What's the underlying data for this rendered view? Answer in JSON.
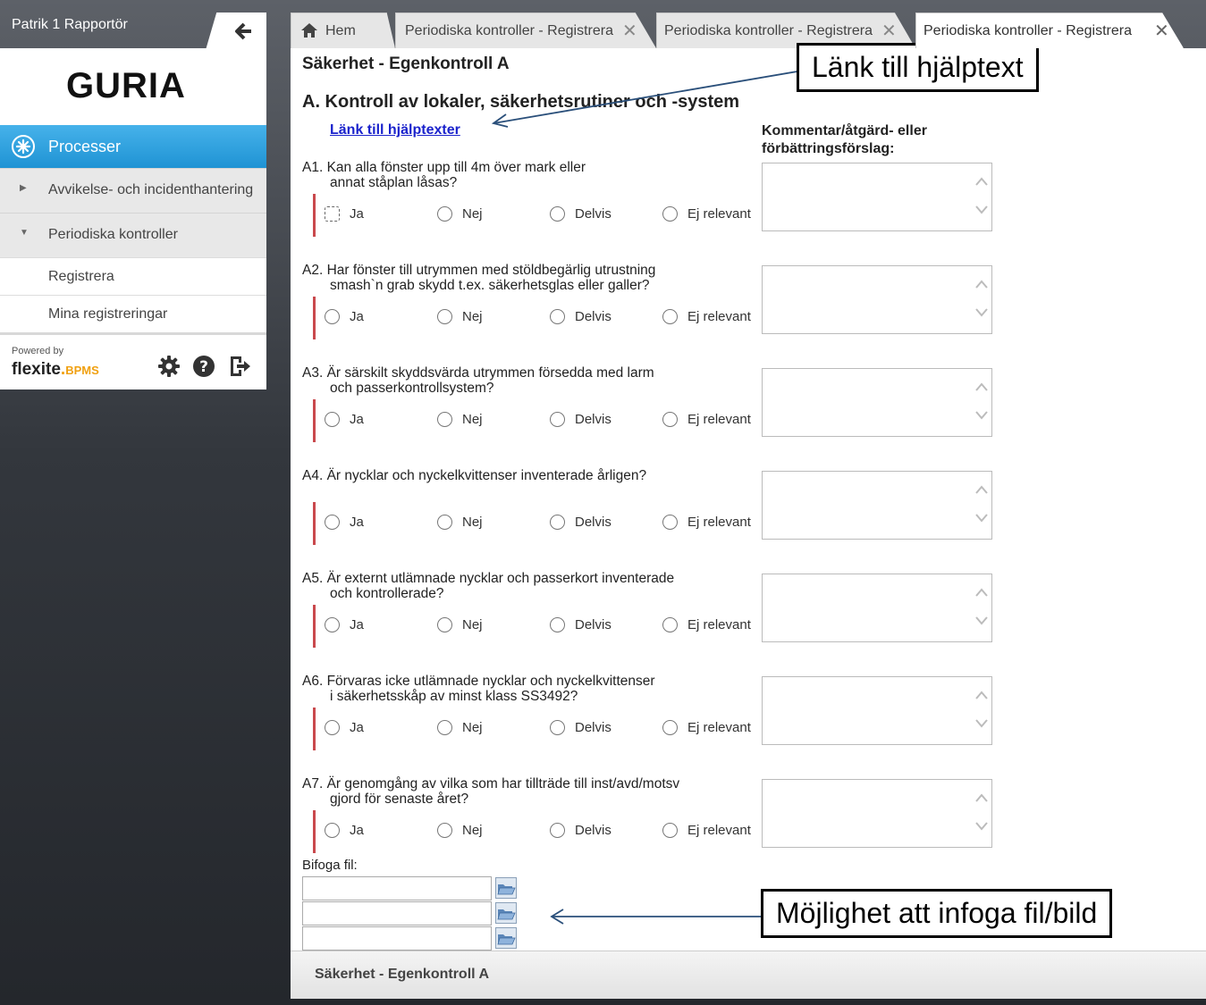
{
  "user": {
    "name": "Patrik 1 Rapportör"
  },
  "brand": "GURIA",
  "nav": {
    "processer": "Processer",
    "groups": [
      {
        "label": "Avvikelse- och incidenthantering"
      },
      {
        "label": "Periodiska kontroller"
      }
    ],
    "subitems": [
      {
        "label": "Registrera"
      },
      {
        "label": "Mina registreringar"
      }
    ],
    "powered_by": "Powered by",
    "logo_text": "flexite",
    "logo_suffix": "BPMS",
    "footer_icons": [
      "gear-icon",
      "help-icon",
      "logout-icon"
    ]
  },
  "tabs": [
    {
      "label": "Hem"
    },
    {
      "label": "Periodiska kontroller - Registrera"
    },
    {
      "label": "Periodiska kontroller - Registrera"
    },
    {
      "label": "Periodiska kontroller - Registrera"
    }
  ],
  "form": {
    "title": "Säkerhet - Egenkontroll A",
    "section": "A. Kontroll av lokaler, säkerhetsrutiner och -system",
    "help_link": "Länk till hjälptexter",
    "comment_header_line1": "Kommentar/åtgärd- eller",
    "comment_header_line2": "förbättringsförslag:",
    "options": [
      "Ja",
      "Nej",
      "Delvis",
      "Ej relevant"
    ],
    "questions": [
      {
        "line1": "A1. Kan alla fönster upp till 4m över mark eller",
        "line2": "annat ståplan låsas?"
      },
      {
        "line1": "A2. Har fönster till utrymmen med stöldbegärlig utrustning",
        "line2": "smash`n grab skydd t.ex. säkerhetsglas eller galler?"
      },
      {
        "line1": "A3. Är särskilt skyddsvärda utrymmen försedda med larm",
        "line2": "och passerkontrollsystem?"
      },
      {
        "line1": "A4. Är nycklar och nyckelkvittenser inventerade årligen?",
        "line2": ""
      },
      {
        "line1": "A5. Är externt utlämnade nycklar och passerkort inventerade",
        "line2": "och kontrollerade?"
      },
      {
        "line1": "A6. Förvaras icke utlämnade nycklar och nyckelkvittenser",
        "line2": "i säkerhetsskåp av minst klass SS3492?"
      },
      {
        "line1": "A7. Är genomgång av vilka som har tillträde till inst/avd/motsv",
        "line2": "gjord för senaste året?"
      }
    ],
    "attach_label": "Bifoga fil:"
  },
  "bottom_bar": {
    "title": "Säkerhet - Egenkontroll A"
  },
  "callouts": {
    "help": "Länk till hjälptext",
    "attach": "Möjlighet att infoga fil/bild"
  },
  "colors": {
    "accent": "#1f93d4",
    "required_bar": "#c9494d",
    "link": "#1a22cc"
  }
}
